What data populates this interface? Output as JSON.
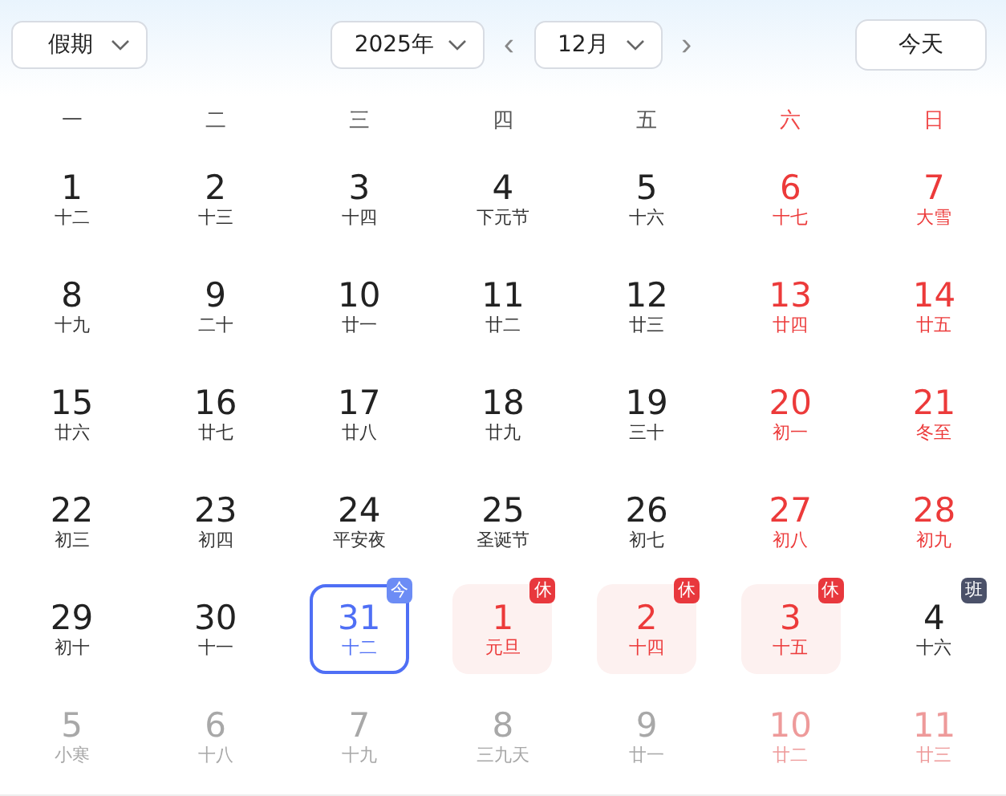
{
  "toolbar": {
    "holiday_select": "假期",
    "year_select": "2025年",
    "month_select": "12月",
    "prev": "‹",
    "next": "›",
    "today_button": "今天"
  },
  "weekdays": [
    {
      "label": "一",
      "weekend": false
    },
    {
      "label": "二",
      "weekend": false
    },
    {
      "label": "三",
      "weekend": false
    },
    {
      "label": "四",
      "weekend": false
    },
    {
      "label": "五",
      "weekend": false
    },
    {
      "label": "六",
      "weekend": true
    },
    {
      "label": "日",
      "weekend": true
    }
  ],
  "weeks": [
    [
      {
        "day": "1",
        "lunar": "十二",
        "weekend": false,
        "dimmed": false,
        "today": false
      },
      {
        "day": "2",
        "lunar": "十三",
        "weekend": false,
        "dimmed": false,
        "today": false
      },
      {
        "day": "3",
        "lunar": "十四",
        "weekend": false,
        "dimmed": false,
        "today": false
      },
      {
        "day": "4",
        "lunar": "下元节",
        "weekend": false,
        "dimmed": false,
        "today": false
      },
      {
        "day": "5",
        "lunar": "十六",
        "weekend": false,
        "dimmed": false,
        "today": false
      },
      {
        "day": "6",
        "lunar": "十七",
        "weekend": true,
        "dimmed": false,
        "today": false
      },
      {
        "day": "7",
        "lunar": "大雪",
        "weekend": true,
        "dimmed": false,
        "today": false
      }
    ],
    [
      {
        "day": "8",
        "lunar": "十九",
        "weekend": false,
        "dimmed": false,
        "today": false
      },
      {
        "day": "9",
        "lunar": "二十",
        "weekend": false,
        "dimmed": false,
        "today": false
      },
      {
        "day": "10",
        "lunar": "廿一",
        "weekend": false,
        "dimmed": false,
        "today": false
      },
      {
        "day": "11",
        "lunar": "廿二",
        "weekend": false,
        "dimmed": false,
        "today": false
      },
      {
        "day": "12",
        "lunar": "廿三",
        "weekend": false,
        "dimmed": false,
        "today": false
      },
      {
        "day": "13",
        "lunar": "廿四",
        "weekend": true,
        "dimmed": false,
        "today": false
      },
      {
        "day": "14",
        "lunar": "廿五",
        "weekend": true,
        "dimmed": false,
        "today": false
      }
    ],
    [
      {
        "day": "15",
        "lunar": "廿六",
        "weekend": false,
        "dimmed": false,
        "today": false
      },
      {
        "day": "16",
        "lunar": "廿七",
        "weekend": false,
        "dimmed": false,
        "today": false
      },
      {
        "day": "17",
        "lunar": "廿八",
        "weekend": false,
        "dimmed": false,
        "today": false
      },
      {
        "day": "18",
        "lunar": "廿九",
        "weekend": false,
        "dimmed": false,
        "today": false
      },
      {
        "day": "19",
        "lunar": "三十",
        "weekend": false,
        "dimmed": false,
        "today": false
      },
      {
        "day": "20",
        "lunar": "初一",
        "weekend": true,
        "dimmed": false,
        "today": false
      },
      {
        "day": "21",
        "lunar": "冬至",
        "weekend": true,
        "dimmed": false,
        "today": false
      }
    ],
    [
      {
        "day": "22",
        "lunar": "初三",
        "weekend": false,
        "dimmed": false,
        "today": false
      },
      {
        "day": "23",
        "lunar": "初四",
        "weekend": false,
        "dimmed": false,
        "today": false
      },
      {
        "day": "24",
        "lunar": "平安夜",
        "weekend": false,
        "dimmed": false,
        "today": false
      },
      {
        "day": "25",
        "lunar": "圣诞节",
        "weekend": false,
        "dimmed": false,
        "today": false
      },
      {
        "day": "26",
        "lunar": "初七",
        "weekend": false,
        "dimmed": false,
        "today": false
      },
      {
        "day": "27",
        "lunar": "初八",
        "weekend": true,
        "dimmed": false,
        "today": false
      },
      {
        "day": "28",
        "lunar": "初九",
        "weekend": true,
        "dimmed": false,
        "today": false
      }
    ],
    [
      {
        "day": "29",
        "lunar": "初十",
        "weekend": false,
        "dimmed": false,
        "today": false
      },
      {
        "day": "30",
        "lunar": "十一",
        "weekend": false,
        "dimmed": false,
        "today": false
      },
      {
        "day": "31",
        "lunar": "十二",
        "weekend": false,
        "dimmed": false,
        "today": true,
        "badge": {
          "text": "今",
          "kind": "today"
        }
      },
      {
        "day": "1",
        "lunar": "元旦",
        "dimmed": false,
        "today": false,
        "badge": {
          "text": "休",
          "kind": "rest"
        }
      },
      {
        "day": "2",
        "lunar": "十四",
        "dimmed": false,
        "today": false,
        "badge": {
          "text": "休",
          "kind": "rest"
        }
      },
      {
        "day": "3",
        "lunar": "十五",
        "dimmed": false,
        "today": false,
        "badge": {
          "text": "休",
          "kind": "rest"
        }
      },
      {
        "day": "4",
        "lunar": "十六",
        "dimmed": false,
        "today": false,
        "badge": {
          "text": "班",
          "kind": "work"
        }
      }
    ],
    [
      {
        "day": "5",
        "lunar": "小寒",
        "weekend": false,
        "dimmed": true,
        "today": false
      },
      {
        "day": "6",
        "lunar": "十八",
        "weekend": false,
        "dimmed": true,
        "today": false
      },
      {
        "day": "7",
        "lunar": "十九",
        "weekend": false,
        "dimmed": true,
        "today": false
      },
      {
        "day": "8",
        "lunar": "三九天",
        "weekend": false,
        "dimmed": true,
        "today": false
      },
      {
        "day": "9",
        "lunar": "廿一",
        "weekend": false,
        "dimmed": true,
        "today": false
      },
      {
        "day": "10",
        "lunar": "廿二",
        "weekend": true,
        "dimmed": true,
        "today": false
      },
      {
        "day": "11",
        "lunar": "廿三",
        "weekend": true,
        "dimmed": true,
        "today": false
      }
    ]
  ]
}
